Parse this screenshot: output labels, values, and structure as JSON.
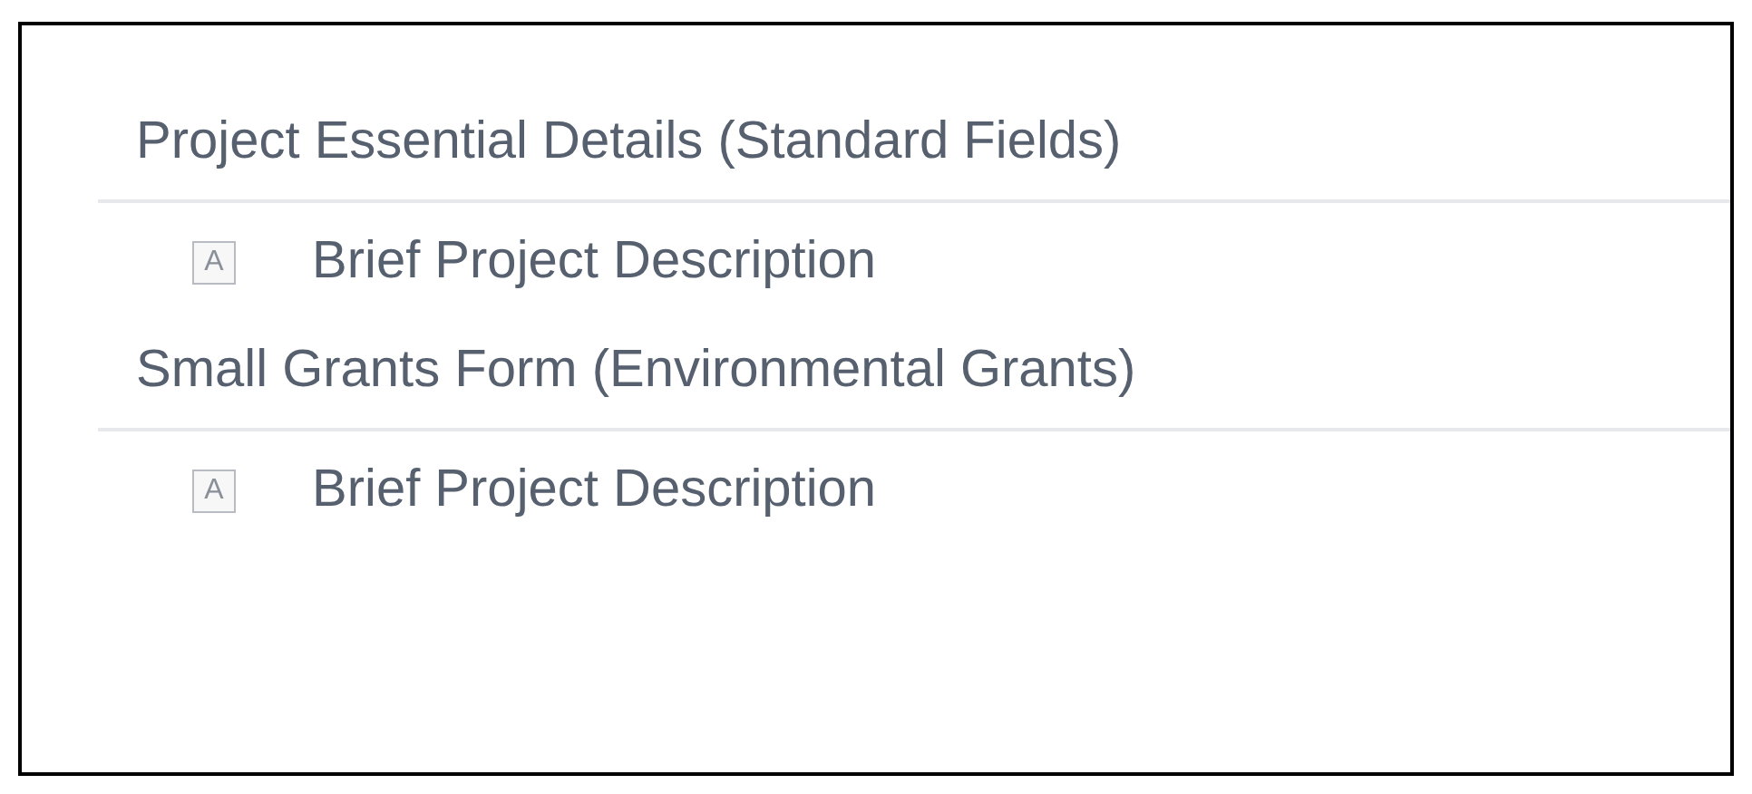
{
  "sections": [
    {
      "title": "Project Essential Details (Standard Fields)",
      "fields": [
        {
          "icon": "A",
          "label": "Brief Project Description"
        }
      ]
    },
    {
      "title": "Small Grants Form (Environmental Grants)",
      "fields": [
        {
          "icon": "A",
          "label": "Brief Project Description"
        }
      ]
    }
  ]
}
